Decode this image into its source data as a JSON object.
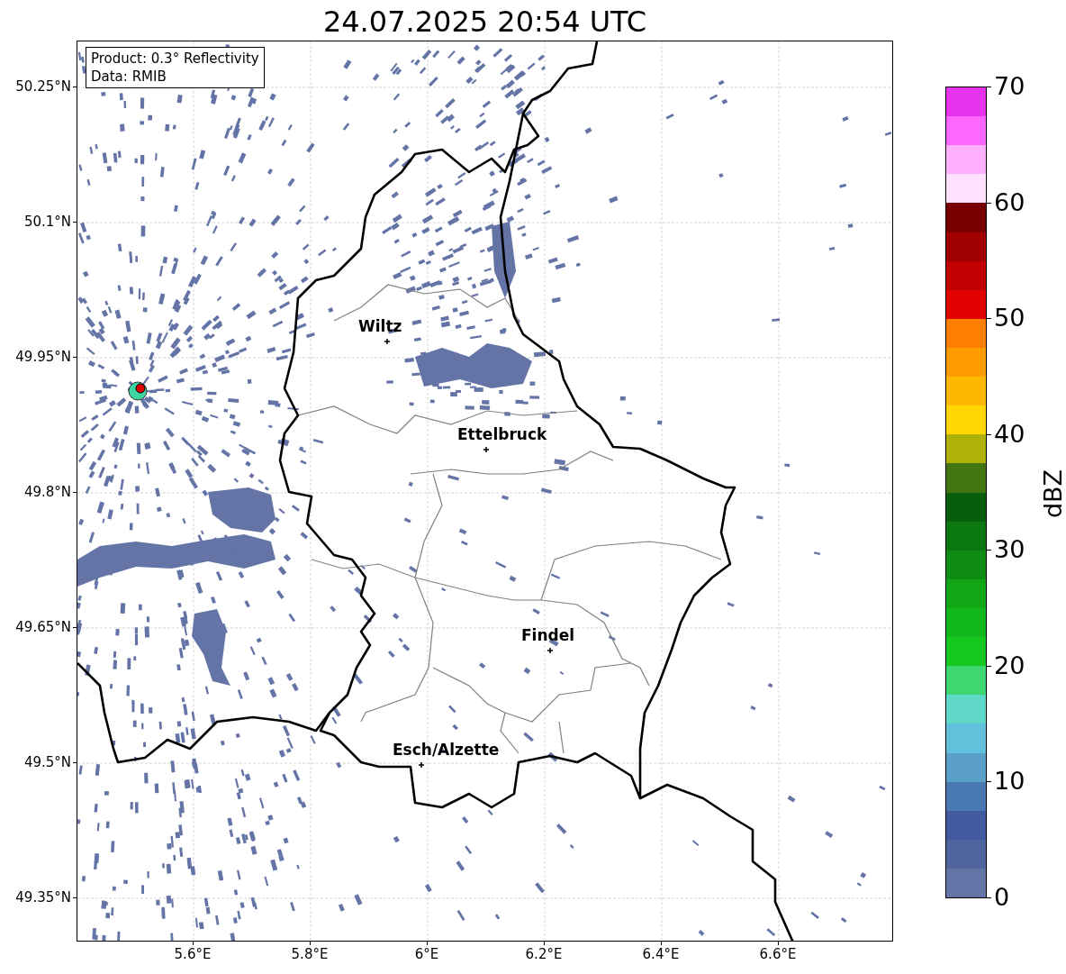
{
  "title": "24.07.2025 20:54 UTC",
  "info_box": {
    "lines": [
      "Product: 0.3° Reflectivity",
      "Data: RMIB"
    ]
  },
  "map": {
    "y_ticks": [
      "50.25°N",
      "50.1°N",
      "49.95°N",
      "49.8°N",
      "49.65°N",
      "49.5°N",
      "49.35°N"
    ],
    "x_ticks": [
      "5.6°E",
      "5.8°E",
      "6°E",
      "6.2°E",
      "6.4°E",
      "6.6°E"
    ],
    "places": [
      {
        "name": "Wiltz"
      },
      {
        "name": "Ettelbruck"
      },
      {
        "name": "Findel"
      },
      {
        "name": "Esch/Alzette"
      }
    ]
  },
  "colorbar": {
    "label": "dBZ",
    "ticks": [
      "70",
      "60",
      "50",
      "40",
      "30",
      "20",
      "10",
      "0"
    ],
    "segments": [
      {
        "color": "#e633ee"
      },
      {
        "color": "#ff66ff"
      },
      {
        "color": "#ffb0ff"
      },
      {
        "color": "#ffe0ff"
      },
      {
        "color": "#780000"
      },
      {
        "color": "#a00000"
      },
      {
        "color": "#c00000"
      },
      {
        "color": "#e00000"
      },
      {
        "color": "#ff7f00"
      },
      {
        "color": "#ff9c00"
      },
      {
        "color": "#ffb800"
      },
      {
        "color": "#ffd600"
      },
      {
        "color": "#b0b00a"
      },
      {
        "color": "#427610"
      },
      {
        "color": "#085e0c"
      },
      {
        "color": "#0c7810"
      },
      {
        "color": "#0f8c14"
      },
      {
        "color": "#12a616"
      },
      {
        "color": "#10b81c"
      },
      {
        "color": "#14c81e"
      },
      {
        "color": "#3dd670"
      },
      {
        "color": "#60d8c8"
      },
      {
        "color": "#63c0dc"
      },
      {
        "color": "#5aa0c8"
      },
      {
        "color": "#4a78b0"
      },
      {
        "color": "#415aa0"
      },
      {
        "color": "#50649e"
      },
      {
        "color": "#6474a6"
      }
    ]
  }
}
